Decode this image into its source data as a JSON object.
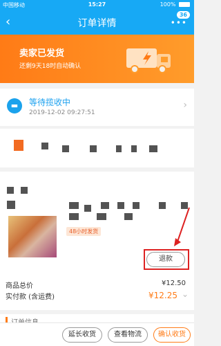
{
  "status_bar": {
    "carrier": "中国移动",
    "time": "15:27",
    "battery": "100%"
  },
  "nav": {
    "title": "订单详情",
    "badge": "36"
  },
  "banner": {
    "title": "卖家已发货",
    "subtitle": "还剩9天18时自动确认"
  },
  "logistics": {
    "status": "等待揽收中",
    "time": "2019-12-02 09:27:51"
  },
  "product": {
    "tag": "48小时发货"
  },
  "actions": {
    "refund": "退款"
  },
  "totals": {
    "label_goods": "商品总价",
    "value_goods": "¥12.50",
    "label_paid": "实付款 (含运费)",
    "value_paid": "¥12.25"
  },
  "order_info": {
    "label": "订单信息"
  },
  "bottom": {
    "extend": "延长收货",
    "view_logistics": "查看物流",
    "confirm": "确认收货"
  },
  "colors": {
    "nav": "#17a9f5",
    "banner": "#ff7b16",
    "accent": "#ff7b16",
    "annotation": "#d22222"
  }
}
